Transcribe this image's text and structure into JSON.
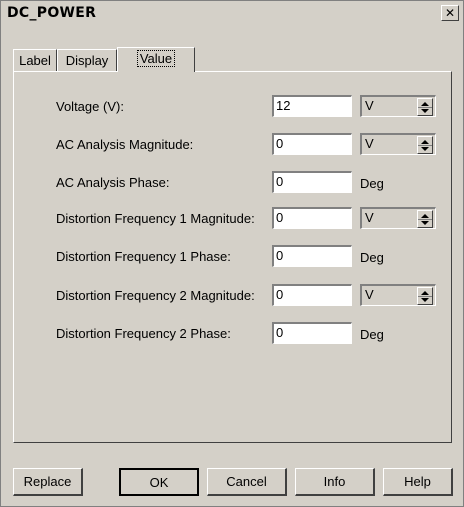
{
  "window": {
    "title": "DC_POWER",
    "close_glyph": "✕"
  },
  "tabs": [
    {
      "label": "Label"
    },
    {
      "label": "Display"
    },
    {
      "label": "Value",
      "active": true
    }
  ],
  "rows": [
    {
      "label": "Voltage (V):",
      "value": "12",
      "unit": "V",
      "unit_type": "select"
    },
    {
      "label": "AC Analysis Magnitude:",
      "value": "0",
      "unit": "V",
      "unit_type": "select"
    },
    {
      "label": "AC Analysis Phase:",
      "value": "0",
      "unit": "Deg",
      "unit_type": "text"
    },
    {
      "label": "Distortion Frequency 1 Magnitude:",
      "value": "0",
      "unit": "V",
      "unit_type": "select"
    },
    {
      "label": "Distortion Frequency 1 Phase:",
      "value": "0",
      "unit": "Deg",
      "unit_type": "text"
    },
    {
      "label": "Distortion Frequency 2 Magnitude:",
      "value": "0",
      "unit": "V",
      "unit_type": "select"
    },
    {
      "label": "Distortion Frequency 2 Phase:",
      "value": "0",
      "unit": "Deg",
      "unit_type": "text"
    }
  ],
  "buttons": {
    "replace": "Replace",
    "ok": "OK",
    "cancel": "Cancel",
    "info": "Info",
    "help": "Help"
  },
  "icons": {
    "close": "close-icon",
    "spin": "spinner-arrows-icon"
  },
  "colors": {
    "face": "#d4d0c8",
    "field": "#ffffff",
    "shadow": "#808080",
    "highlight": "#ffffff"
  }
}
